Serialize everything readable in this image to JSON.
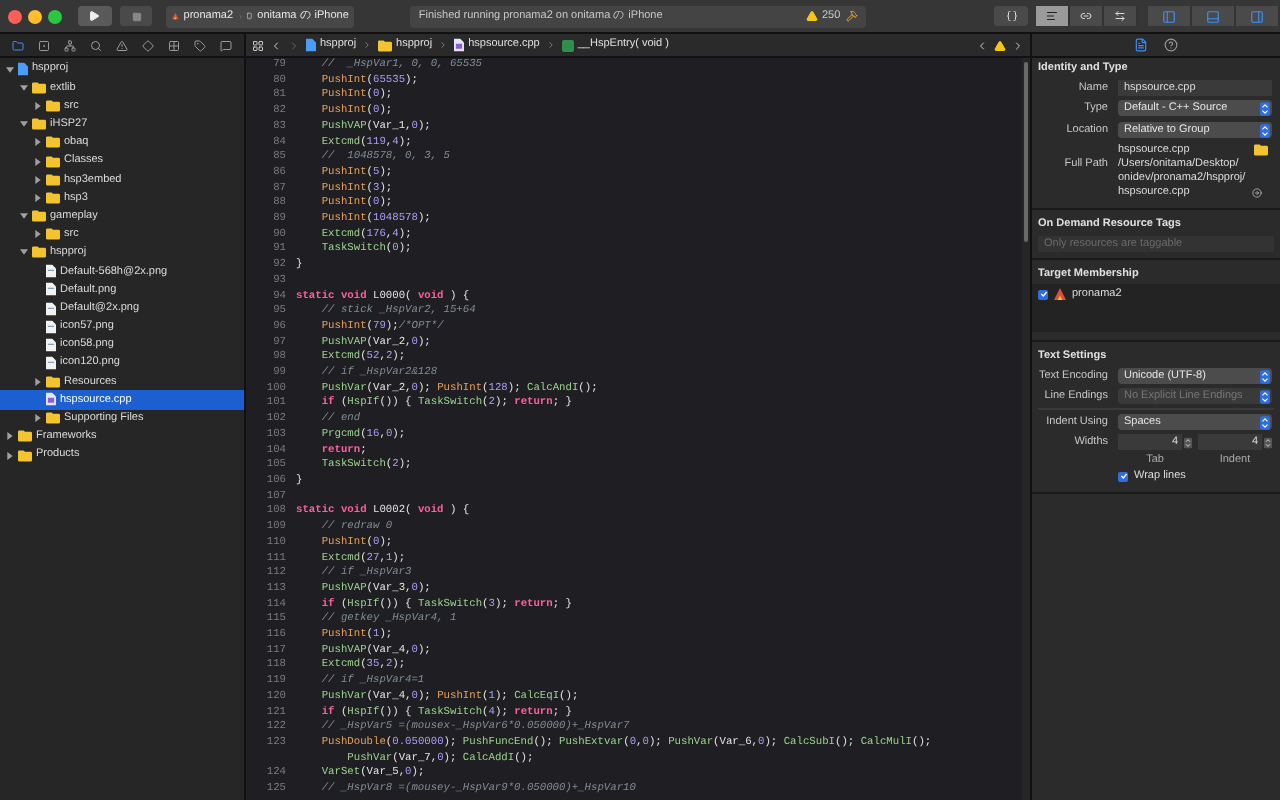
{
  "toolbar": {
    "scheme": {
      "target": "pronama2",
      "device": "onitama の iPhone"
    },
    "status": "Finished running pronama2 on onitama の iPhone",
    "warnings": "250",
    "editor_modes": [
      {
        "kind": "standard",
        "selected": true
      },
      {
        "kind": "assistant",
        "selected": false
      },
      {
        "kind": "version",
        "selected": false
      }
    ],
    "panels": [
      {
        "kind": "navigator",
        "on": true
      },
      {
        "kind": "debug",
        "on": true
      },
      {
        "kind": "utilities",
        "on": true
      }
    ]
  },
  "navigator_tabs": [
    {
      "kind": "project",
      "selected": true
    },
    {
      "kind": "source_control",
      "selected": false
    },
    {
      "kind": "symbol",
      "selected": false
    },
    {
      "kind": "find",
      "selected": false
    },
    {
      "kind": "issue",
      "selected": false
    },
    {
      "kind": "test",
      "selected": false
    },
    {
      "kind": "debug",
      "selected": false
    },
    {
      "kind": "breakpoint",
      "selected": false
    },
    {
      "kind": "report",
      "selected": false
    }
  ],
  "tree": [
    {
      "label": "hspproj",
      "kind": "project",
      "expanded": true,
      "selected": false,
      "children": [
        {
          "label": "extlib",
          "kind": "folder",
          "expanded": true,
          "selected": false,
          "children": [
            {
              "label": "src",
              "kind": "folder",
              "expanded": false,
              "selected": false
            }
          ]
        },
        {
          "label": "iHSP27",
          "kind": "folder",
          "expanded": true,
          "selected": false,
          "children": [
            {
              "label": "obaq",
              "kind": "folder",
              "expanded": false,
              "selected": false
            },
            {
              "label": "Classes",
              "kind": "folder",
              "expanded": false,
              "selected": false
            },
            {
              "label": "hsp3embed",
              "kind": "folder",
              "expanded": false,
              "selected": false
            },
            {
              "label": "hsp3",
              "kind": "folder",
              "expanded": false,
              "selected": false
            }
          ]
        },
        {
          "label": "gameplay",
          "kind": "folder",
          "expanded": true,
          "selected": false,
          "children": [
            {
              "label": "src",
              "kind": "folder",
              "expanded": false,
              "selected": false
            }
          ]
        },
        {
          "label": "hspproj",
          "kind": "folder",
          "expanded": true,
          "selected": false,
          "children": [
            {
              "label": "Default-568h@2x.png",
              "kind": "image",
              "selected": false
            },
            {
              "label": "Default.png",
              "kind": "image",
              "selected": false
            },
            {
              "label": "Default@2x.png",
              "kind": "image",
              "selected": false
            },
            {
              "label": "icon57.png",
              "kind": "image",
              "selected": false
            },
            {
              "label": "icon58.png",
              "kind": "image",
              "selected": false
            },
            {
              "label": "icon120.png",
              "kind": "image",
              "selected": false
            },
            {
              "label": "Resources",
              "kind": "folder",
              "expanded": false,
              "selected": false
            },
            {
              "label": "hspsource.cpp",
              "kind": "source",
              "selected": true
            },
            {
              "label": "Supporting Files",
              "kind": "folder",
              "expanded": false,
              "selected": false
            }
          ]
        }
      ]
    },
    {
      "label": "Frameworks",
      "kind": "folder",
      "expanded": false,
      "selected": false
    },
    {
      "label": "Products",
      "kind": "folder",
      "expanded": false,
      "selected": false
    }
  ],
  "jump_bar": [
    {
      "kind": "project",
      "label": "hspproj"
    },
    {
      "kind": "folder",
      "label": "hspproj"
    },
    {
      "kind": "source",
      "label": "hspsource.cpp"
    },
    {
      "kind": "function",
      "label": "__HspEntry( void )"
    }
  ],
  "code": [
    {
      "number": "79",
      "tokens": [
        {
          "kind": "comment",
          "text": "    //  _HspVar1, 0, 0, 65535"
        }
      ]
    },
    {
      "number": "80",
      "tokens": [
        {
          "kind": "push",
          "text": "    PushInt"
        },
        {
          "kind": "plain",
          "text": "("
        },
        {
          "kind": "number",
          "text": "65535"
        },
        {
          "kind": "plain",
          "text": ");"
        }
      ]
    },
    {
      "number": "81",
      "tokens": [
        {
          "kind": "push",
          "text": "    PushInt"
        },
        {
          "kind": "plain",
          "text": "("
        },
        {
          "kind": "number",
          "text": "0"
        },
        {
          "kind": "plain",
          "text": ");"
        }
      ]
    },
    {
      "number": "82",
      "tokens": [
        {
          "kind": "push",
          "text": "    PushInt"
        },
        {
          "kind": "plain",
          "text": "("
        },
        {
          "kind": "number",
          "text": "0"
        },
        {
          "kind": "plain",
          "text": ");"
        }
      ]
    },
    {
      "number": "83",
      "tokens": [
        {
          "kind": "call",
          "text": "    PushVAP"
        },
        {
          "kind": "plain",
          "text": "(Var_1,"
        },
        {
          "kind": "number",
          "text": "0"
        },
        {
          "kind": "plain",
          "text": ");"
        }
      ]
    },
    {
      "number": "84",
      "tokens": [
        {
          "kind": "call",
          "text": "    Extcmd"
        },
        {
          "kind": "plain",
          "text": "("
        },
        {
          "kind": "number",
          "text": "119"
        },
        {
          "kind": "plain",
          "text": ","
        },
        {
          "kind": "number",
          "text": "4"
        },
        {
          "kind": "plain",
          "text": ");"
        }
      ]
    },
    {
      "number": "85",
      "tokens": [
        {
          "kind": "comment",
          "text": "    //  1048578, 0, 3, 5"
        }
      ]
    },
    {
      "number": "86",
      "tokens": [
        {
          "kind": "push",
          "text": "    PushInt"
        },
        {
          "kind": "plain",
          "text": "("
        },
        {
          "kind": "number",
          "text": "5"
        },
        {
          "kind": "plain",
          "text": ");"
        }
      ]
    },
    {
      "number": "87",
      "tokens": [
        {
          "kind": "push",
          "text": "    PushInt"
        },
        {
          "kind": "plain",
          "text": "("
        },
        {
          "kind": "number",
          "text": "3"
        },
        {
          "kind": "plain",
          "text": ");"
        }
      ]
    },
    {
      "number": "88",
      "tokens": [
        {
          "kind": "push",
          "text": "    PushInt"
        },
        {
          "kind": "plain",
          "text": "("
        },
        {
          "kind": "number",
          "text": "0"
        },
        {
          "kind": "plain",
          "text": ");"
        }
      ]
    },
    {
      "number": "89",
      "tokens": [
        {
          "kind": "push",
          "text": "    PushInt"
        },
        {
          "kind": "plain",
          "text": "("
        },
        {
          "kind": "number",
          "text": "1048578"
        },
        {
          "kind": "plain",
          "text": ");"
        }
      ]
    },
    {
      "number": "90",
      "tokens": [
        {
          "kind": "call",
          "text": "    Extcmd"
        },
        {
          "kind": "plain",
          "text": "("
        },
        {
          "kind": "number",
          "text": "176"
        },
        {
          "kind": "plain",
          "text": ","
        },
        {
          "kind": "number",
          "text": "4"
        },
        {
          "kind": "plain",
          "text": ");"
        }
      ]
    },
    {
      "number": "91",
      "tokens": [
        {
          "kind": "call",
          "text": "    TaskSwitch"
        },
        {
          "kind": "plain",
          "text": "("
        },
        {
          "kind": "number",
          "text": "0"
        },
        {
          "kind": "plain",
          "text": ");"
        }
      ]
    },
    {
      "number": "92",
      "tokens": [
        {
          "kind": "plain",
          "text": "}"
        }
      ]
    },
    {
      "number": "93"
    },
    {
      "number": "94",
      "tokens": [
        {
          "kind": "keyword",
          "text": "static void"
        },
        {
          "kind": "plain",
          "text": " L0000( "
        },
        {
          "kind": "keyword",
          "text": "void"
        },
        {
          "kind": "plain",
          "text": " ) {"
        }
      ]
    },
    {
      "number": "95",
      "tokens": [
        {
          "kind": "comment",
          "text": "    // stick _HspVar2, 15+64"
        }
      ]
    },
    {
      "number": "96",
      "tokens": [
        {
          "kind": "push",
          "text": "    PushInt"
        },
        {
          "kind": "plain",
          "text": "("
        },
        {
          "kind": "number",
          "text": "79"
        },
        {
          "kind": "plain",
          "text": ");"
        },
        {
          "kind": "comment",
          "text": "/*OPT*/"
        }
      ]
    },
    {
      "number": "97",
      "tokens": [
        {
          "kind": "call",
          "text": "    PushVAP"
        },
        {
          "kind": "plain",
          "text": "(Var_2,"
        },
        {
          "kind": "number",
          "text": "0"
        },
        {
          "kind": "plain",
          "text": ");"
        }
      ]
    },
    {
      "number": "98",
      "tokens": [
        {
          "kind": "call",
          "text": "    Extcmd"
        },
        {
          "kind": "plain",
          "text": "("
        },
        {
          "kind": "number",
          "text": "52"
        },
        {
          "kind": "plain",
          "text": ","
        },
        {
          "kind": "number",
          "text": "2"
        },
        {
          "kind": "plain",
          "text": ");"
        }
      ]
    },
    {
      "number": "99",
      "tokens": [
        {
          "kind": "comment",
          "text": "    // if _HspVar2&128"
        }
      ]
    },
    {
      "number": "100",
      "tokens": [
        {
          "kind": "call",
          "text": "    PushVar"
        },
        {
          "kind": "plain",
          "text": "(Var_2,"
        },
        {
          "kind": "number",
          "text": "0"
        },
        {
          "kind": "plain",
          "text": "); "
        },
        {
          "kind": "push",
          "text": "PushInt"
        },
        {
          "kind": "plain",
          "text": "("
        },
        {
          "kind": "number",
          "text": "128"
        },
        {
          "kind": "plain",
          "text": "); "
        },
        {
          "kind": "call",
          "text": "CalcAndI"
        },
        {
          "kind": "plain",
          "text": "();"
        }
      ]
    },
    {
      "number": "101",
      "tokens": [
        {
          "kind": "keyword",
          "text": "    if"
        },
        {
          "kind": "plain",
          "text": " ("
        },
        {
          "kind": "call",
          "text": "HspIf"
        },
        {
          "kind": "plain",
          "text": "()) { "
        },
        {
          "kind": "call",
          "text": "TaskSwitch"
        },
        {
          "kind": "plain",
          "text": "("
        },
        {
          "kind": "number",
          "text": "2"
        },
        {
          "kind": "plain",
          "text": "); "
        },
        {
          "kind": "keyword",
          "text": "return"
        },
        {
          "kind": "plain",
          "text": "; }"
        }
      ]
    },
    {
      "number": "102",
      "tokens": [
        {
          "kind": "comment",
          "text": "    // end"
        }
      ]
    },
    {
      "number": "103",
      "tokens": [
        {
          "kind": "call",
          "text": "    Prgcmd"
        },
        {
          "kind": "plain",
          "text": "("
        },
        {
          "kind": "number",
          "text": "16"
        },
        {
          "kind": "plain",
          "text": ","
        },
        {
          "kind": "number",
          "text": "0"
        },
        {
          "kind": "plain",
          "text": ");"
        }
      ]
    },
    {
      "number": "104",
      "tokens": [
        {
          "kind": "keyword",
          "text": "    return"
        },
        {
          "kind": "plain",
          "text": ";"
        }
      ]
    },
    {
      "number": "105",
      "tokens": [
        {
          "kind": "call",
          "text": "    TaskSwitch"
        },
        {
          "kind": "plain",
          "text": "("
        },
        {
          "kind": "number",
          "text": "2"
        },
        {
          "kind": "plain",
          "text": ");"
        }
      ]
    },
    {
      "number": "106",
      "tokens": [
        {
          "kind": "plain",
          "text": "}"
        }
      ]
    },
    {
      "number": "107"
    },
    {
      "number": "108",
      "tokens": [
        {
          "kind": "keyword",
          "text": "static void"
        },
        {
          "kind": "plain",
          "text": " L0002( "
        },
        {
          "kind": "keyword",
          "text": "void"
        },
        {
          "kind": "plain",
          "text": " ) {"
        }
      ]
    },
    {
      "number": "109",
      "tokens": [
        {
          "kind": "comment",
          "text": "    // redraw 0"
        }
      ]
    },
    {
      "number": "110",
      "tokens": [
        {
          "kind": "push",
          "text": "    PushInt"
        },
        {
          "kind": "plain",
          "text": "("
        },
        {
          "kind": "number",
          "text": "0"
        },
        {
          "kind": "plain",
          "text": ");"
        }
      ]
    },
    {
      "number": "111",
      "tokens": [
        {
          "kind": "call",
          "text": "    Extcmd"
        },
        {
          "kind": "plain",
          "text": "("
        },
        {
          "kind": "number",
          "text": "27"
        },
        {
          "kind": "plain",
          "text": ","
        },
        {
          "kind": "number",
          "text": "1"
        },
        {
          "kind": "plain",
          "text": ");"
        }
      ]
    },
    {
      "number": "112",
      "tokens": [
        {
          "kind": "comment",
          "text": "    // if _HspVar3"
        }
      ]
    },
    {
      "number": "113",
      "tokens": [
        {
          "kind": "call",
          "text": "    PushVAP"
        },
        {
          "kind": "plain",
          "text": "(Var_3,"
        },
        {
          "kind": "number",
          "text": "0"
        },
        {
          "kind": "plain",
          "text": ");"
        }
      ]
    },
    {
      "number": "114",
      "tokens": [
        {
          "kind": "keyword",
          "text": "    if"
        },
        {
          "kind": "plain",
          "text": " ("
        },
        {
          "kind": "call",
          "text": "HspIf"
        },
        {
          "kind": "plain",
          "text": "()) { "
        },
        {
          "kind": "call",
          "text": "TaskSwitch"
        },
        {
          "kind": "plain",
          "text": "("
        },
        {
          "kind": "number",
          "text": "3"
        },
        {
          "kind": "plain",
          "text": "); "
        },
        {
          "kind": "keyword",
          "text": "return"
        },
        {
          "kind": "plain",
          "text": "; }"
        }
      ]
    },
    {
      "number": "115",
      "tokens": [
        {
          "kind": "comment",
          "text": "    // getkey _HspVar4, 1"
        }
      ]
    },
    {
      "number": "116",
      "tokens": [
        {
          "kind": "push",
          "text": "    PushInt"
        },
        {
          "kind": "plain",
          "text": "("
        },
        {
          "kind": "number",
          "text": "1"
        },
        {
          "kind": "plain",
          "text": ");"
        }
      ]
    },
    {
      "number": "117",
      "tokens": [
        {
          "kind": "call",
          "text": "    PushVAP"
        },
        {
          "kind": "plain",
          "text": "(Var_4,"
        },
        {
          "kind": "number",
          "text": "0"
        },
        {
          "kind": "plain",
          "text": ");"
        }
      ]
    },
    {
      "number": "118",
      "tokens": [
        {
          "kind": "call",
          "text": "    Extcmd"
        },
        {
          "kind": "plain",
          "text": "("
        },
        {
          "kind": "number",
          "text": "35"
        },
        {
          "kind": "plain",
          "text": ","
        },
        {
          "kind": "number",
          "text": "2"
        },
        {
          "kind": "plain",
          "text": ");"
        }
      ]
    },
    {
      "number": "119",
      "tokens": [
        {
          "kind": "comment",
          "text": "    // if _HspVar4=1"
        }
      ]
    },
    {
      "number": "120",
      "tokens": [
        {
          "kind": "call",
          "text": "    PushVar"
        },
        {
          "kind": "plain",
          "text": "(Var_4,"
        },
        {
          "kind": "number",
          "text": "0"
        },
        {
          "kind": "plain",
          "text": "); "
        },
        {
          "kind": "push",
          "text": "PushInt"
        },
        {
          "kind": "plain",
          "text": "("
        },
        {
          "kind": "number",
          "text": "1"
        },
        {
          "kind": "plain",
          "text": "); "
        },
        {
          "kind": "call",
          "text": "CalcEqI"
        },
        {
          "kind": "plain",
          "text": "();"
        }
      ]
    },
    {
      "number": "121",
      "tokens": [
        {
          "kind": "keyword",
          "text": "    if"
        },
        {
          "kind": "plain",
          "text": " ("
        },
        {
          "kind": "call",
          "text": "HspIf"
        },
        {
          "kind": "plain",
          "text": "()) { "
        },
        {
          "kind": "call",
          "text": "TaskSwitch"
        },
        {
          "kind": "plain",
          "text": "("
        },
        {
          "kind": "number",
          "text": "4"
        },
        {
          "kind": "plain",
          "text": "); "
        },
        {
          "kind": "keyword",
          "text": "return"
        },
        {
          "kind": "plain",
          "text": "; }"
        }
      ]
    },
    {
      "number": "122",
      "tokens": [
        {
          "kind": "comment",
          "text": "    // _HspVar5 =(mousex-_HspVar6*0.050000)+_HspVar7"
        }
      ]
    },
    {
      "number": "123",
      "tokens": [
        {
          "kind": "push",
          "text": "    PushDouble"
        },
        {
          "kind": "plain",
          "text": "("
        },
        {
          "kind": "number",
          "text": "0.050000"
        },
        {
          "kind": "plain",
          "text": "); "
        },
        {
          "kind": "call",
          "text": "PushFuncEnd"
        },
        {
          "kind": "plain",
          "text": "(); "
        },
        {
          "kind": "call",
          "text": "PushExtvar"
        },
        {
          "kind": "plain",
          "text": "("
        },
        {
          "kind": "number",
          "text": "0"
        },
        {
          "kind": "plain",
          "text": ","
        },
        {
          "kind": "number",
          "text": "0"
        },
        {
          "kind": "plain",
          "text": "); "
        },
        {
          "kind": "call",
          "text": "PushVar"
        },
        {
          "kind": "plain",
          "text": "(Var_6,"
        },
        {
          "kind": "number",
          "text": "0"
        },
        {
          "kind": "plain",
          "text": "); "
        },
        {
          "kind": "call",
          "text": "CalcSubI"
        },
        {
          "kind": "plain",
          "text": "(); "
        },
        {
          "kind": "call",
          "text": "CalcMulI"
        },
        {
          "kind": "plain",
          "text": "(); "
        },
        {
          "kind": "call",
          "text": "PushVar"
        },
        {
          "kind": "plain",
          "text": "(Var_7,"
        },
        {
          "kind": "number",
          "text": "0"
        },
        {
          "kind": "plain",
          "text": "); "
        },
        {
          "kind": "call",
          "text": "CalcAddI"
        },
        {
          "kind": "plain",
          "text": "();"
        }
      ]
    },
    {
      "number": "124",
      "tokens": [
        {
          "kind": "call",
          "text": "    VarSet"
        },
        {
          "kind": "plain",
          "text": "(Var_5,"
        },
        {
          "kind": "number",
          "text": "0"
        },
        {
          "kind": "plain",
          "text": ");"
        }
      ]
    },
    {
      "number": "125",
      "tokens": [
        {
          "kind": "comment",
          "text": "    // _HspVar8 =(mousey-_HspVar9*0.050000)+_HspVar10"
        }
      ]
    }
  ],
  "inspector": {
    "tabs": [
      {
        "kind": "file",
        "selected": true
      },
      {
        "kind": "help",
        "selected": false
      }
    ],
    "identity": {
      "title": "Identity and Type",
      "name": {
        "label": "Name",
        "value": "hspsource.cpp"
      },
      "type": {
        "label": "Type",
        "value": "Default - C++ Source"
      },
      "location": {
        "label": "Location",
        "value": "Relative to Group"
      },
      "file_name": "hspsource.cpp",
      "full_path": {
        "label": "Full Path",
        "value": "/Users/onitama/Desktop/onidev/pronama2/hspproj/hspsource.cpp"
      }
    },
    "tags": {
      "title": "On Demand Resource Tags",
      "placeholder": "Only resources are taggable"
    },
    "membership": {
      "title": "Target Membership",
      "targets": [
        {
          "name": "pronama2",
          "checked": true
        }
      ]
    },
    "text_settings": {
      "title": "Text Settings",
      "encoding": {
        "label": "Text Encoding",
        "value": "Unicode (UTF-8)",
        "disabled": false
      },
      "line_endings": {
        "label": "Line Endings",
        "value": "No Explicit Line Endings",
        "disabled": true
      },
      "indent": {
        "label": "Indent Using",
        "value": "Spaces",
        "disabled": false
      },
      "widths_label": "Widths",
      "tab": {
        "value": "4",
        "label": "Tab"
      },
      "indent_width": {
        "value": "4",
        "label": "Indent"
      },
      "wrap": {
        "label": "Wrap lines",
        "checked": true
      }
    }
  }
}
